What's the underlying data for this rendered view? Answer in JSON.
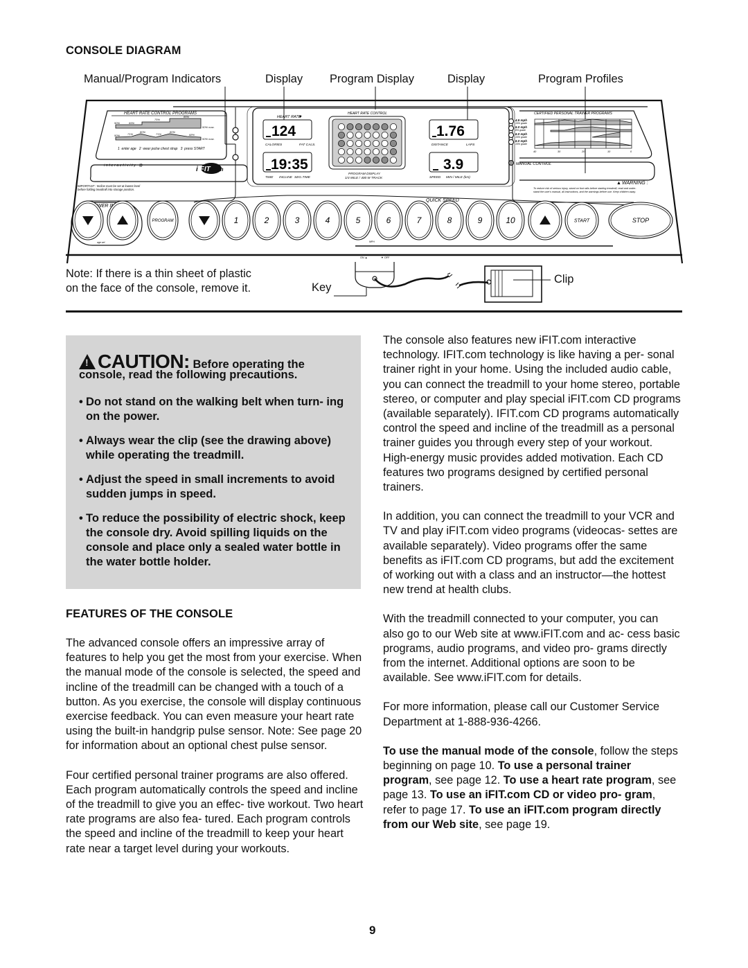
{
  "headings": {
    "console_diagram": "CONSOLE DIAGRAM",
    "features": "FEATURES OF THE CONSOLE"
  },
  "callouts": {
    "manual_program_indicators": "Manual/Program Indicators",
    "display_left": "Display",
    "program_display": "Program Display",
    "display_right": "Display",
    "program_profiles": "Program Profiles",
    "key": "Key",
    "clip": "Clip"
  },
  "note": {
    "line1": "Note: If there is a thin sheet of plastic",
    "line2": "on the face of the console, remove it."
  },
  "console": {
    "hr_programs_title": "HEART RATE  CONTROL PROGRAMS",
    "hr_prog1_labels": [
      "50%",
      "65%",
      "75%",
      "85%",
      "50% max."
    ],
    "hr_prog2_labels": [
      "50%",
      "71%",
      "80%",
      "71%",
      "80%",
      "68%",
      "50% max."
    ],
    "hr_steps": "1  enter age   2  wear pulse chest strap   3  press START",
    "interactivity": "i n t e r a c t i v i t y   @",
    "ifit_logo": "iFIT.com",
    "important": "IMPORTANT : Incline must be set at lowest level",
    "important2": "before folding treadmill into storage position.",
    "heart_rate_label": "HEART RATE",
    "lcd_heart_rate": "124",
    "lcd_heart_rate_labels": [
      "CALORIES",
      "FAT CALS."
    ],
    "lcd_time": "19:35",
    "lcd_time_labels": [
      "TIME",
      "INCLINE",
      "SEG.TIME"
    ],
    "matrix_title": "HEART RATE  CONTROL",
    "matrix_label1": "PROGRAM DISPLAY",
    "matrix_label2": "1/4 MILE / 400 M TRACK",
    "matrix_rows": [
      [
        0,
        1,
        1,
        1,
        1,
        1,
        0
      ],
      [
        1,
        0,
        0,
        0,
        0,
        0,
        1
      ],
      [
        1,
        0,
        0,
        0,
        0,
        0,
        1
      ],
      [
        0,
        0,
        0,
        0,
        0,
        0,
        1
      ],
      [
        0,
        0,
        0,
        1,
        1,
        1,
        0
      ]
    ],
    "lcd_distance": "1.76",
    "lcd_distance_labels": [
      "DISTANCE",
      "LAPS"
    ],
    "lcd_speed": "3.9",
    "lcd_speed_labels": [
      "SPEED",
      "MIN / MILE (km)"
    ],
    "trainer_title": "CERTIFIED PERSONAL TRAINER PROGRAMS",
    "trainer_programs": [
      {
        "speed": "4.5 mph",
        "grade": "10% grade"
      },
      {
        "speed": "5.0 mph",
        "grade": "8% grade"
      },
      {
        "speed": "6.0 mph",
        "grade": "10% grade"
      },
      {
        "speed": "6.0 mph",
        "grade": "10% grade"
      }
    ],
    "trainer_axis": [
      "40",
      "30",
      "20",
      "10",
      "0"
    ],
    "manual_control": "MANUAL CONTROL",
    "warning_title": "WARNING :",
    "warning_text1": "To reduce risk of serious injury, stand on foot rails before starting treadmill, read and under-",
    "warning_text2": "stand the user's manual, all instructions, and the warnings before use.  Keep children away.",
    "power_incline_label": "POWER INCLINE",
    "age_set": "age set",
    "program_button": "PROGRAM",
    "quick_speed_label": "QUICK SPEED",
    "quick_speed_buttons": [
      "1",
      "2",
      "3",
      "4",
      "5",
      "6",
      "7",
      "8",
      "9",
      "10"
    ],
    "mph": "MPH",
    "start_button": "START",
    "stop_button": "STOP",
    "on_label": "ON",
    "off_label": "OFF"
  },
  "caution": {
    "word": "CAUTION:",
    "lead": " Before operating the",
    "lead2": "console, read the following precautions.",
    "items": [
      "Do not stand on the walking belt when turn- ing on the power.",
      "Always wear the clip (see the drawing above) while operating the treadmill.",
      "Adjust the speed in small increments to avoid sudden jumps in speed.",
      "To reduce the possibility of electric shock, keep the console dry. Avoid spilling liquids on the console and place only a sealed water bottle in the water bottle holder."
    ]
  },
  "left_column": {
    "p1": "The advanced console offers an impressive array of features to help you get the most from your exercise. When the manual mode of the console is selected, the speed and incline of the treadmill can be changed with a touch of a button. As you exercise, the console will display continuous exercise feedback. You can even measure your heart rate using the built-in handgrip pulse sensor. Note: See page 20 for information about an optional chest pulse sensor.",
    "p2": "Four certified personal trainer programs are also offered. Each program automatically controls the speed and incline of the treadmill to give you an effec- tive workout. Two heart rate programs are also fea- tured. Each program controls the speed and incline of the treadmill to keep your heart rate near a target level during your workouts."
  },
  "right_column": {
    "p1": "The console also features new iFIT.com interactive technology. IFIT.com technology is like having a per- sonal trainer right in your home. Using the included audio cable, you can connect the treadmill to your home stereo, portable stereo, or computer and play special iFIT.com CD programs (available separately). IFIT.com CD programs automatically control the speed and incline of the treadmill as a personal trainer guides you through every step of your workout. High-energy music provides added motivation. Each CD features two programs designed by certified personal trainers.",
    "p2": "In addition, you can connect the treadmill to your VCR and TV and play iFIT.com video programs (videocas- settes are available separately). Video programs offer the same benefits as iFIT.com CD programs, but add the excitement of working out with a class and an instructor—the hottest new trend at health clubs.",
    "p3": "With the treadmill connected to your computer, you can also go to our Web site at www.iFIT.com and ac- cess basic programs, audio programs, and video pro- grams directly from the internet. Additional options are soon to be available. See www.iFIT.com for details.",
    "p4": "For more information, please call our Customer Service Department at 1-888-936-4266.",
    "p5_parts": [
      {
        "b": "To use the manual mode of the console"
      },
      {
        "t": ", follow the steps beginning on page 10. "
      },
      {
        "b": "To use a personal trainer program"
      },
      {
        "t": ", see page 12. "
      },
      {
        "b": "To use a heart rate program"
      },
      {
        "t": ", see page 13. "
      },
      {
        "b": "To use an iFIT.com CD or video pro- gram"
      },
      {
        "t": ", refer to page 17. "
      },
      {
        "b": "To use an iFIT.com program directly from our Web site"
      },
      {
        "t": ", see page 19."
      }
    ]
  },
  "page_number": "9"
}
